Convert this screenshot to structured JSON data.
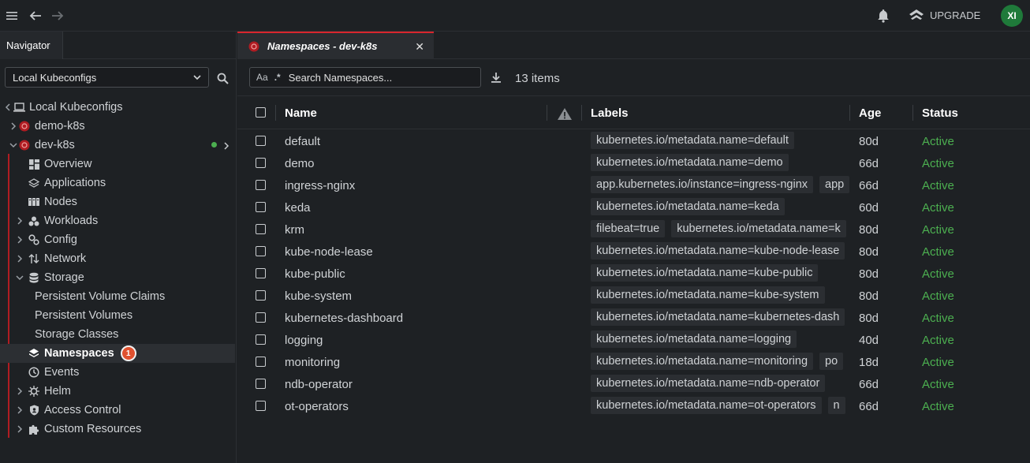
{
  "topbar": {
    "upgrade_label": "UPGRADE",
    "avatar_initials": "XI"
  },
  "sidebar": {
    "tab_label": "Navigator",
    "config_select": "Local Kubeconfigs",
    "tree": [
      {
        "label": "Local Kubeconfigs",
        "icon": "laptop-icon"
      },
      {
        "label": "demo-k8s",
        "icon": "cluster-icon"
      },
      {
        "label": "dev-k8s",
        "icon": "cluster-icon"
      },
      {
        "label": "Overview",
        "icon": "overview-icon"
      },
      {
        "label": "Applications",
        "icon": "applications-icon"
      },
      {
        "label": "Nodes",
        "icon": "nodes-icon"
      },
      {
        "label": "Workloads",
        "icon": "workloads-icon"
      },
      {
        "label": "Config",
        "icon": "config-icon"
      },
      {
        "label": "Network",
        "icon": "network-icon"
      },
      {
        "label": "Storage",
        "icon": "storage-icon"
      },
      {
        "label": "Persistent Volume Claims",
        "icon": ""
      },
      {
        "label": "Persistent Volumes",
        "icon": ""
      },
      {
        "label": "Storage Classes",
        "icon": ""
      },
      {
        "label": "Namespaces",
        "icon": "layers-icon",
        "badge": "1"
      },
      {
        "label": "Events",
        "icon": "clock-icon"
      },
      {
        "label": "Helm",
        "icon": "helm-icon"
      },
      {
        "label": "Access Control",
        "icon": "shield-icon"
      },
      {
        "label": "Custom Resources",
        "icon": "puzzle-icon"
      }
    ]
  },
  "main": {
    "tab_title": "Namespaces - dev-k8s",
    "search": {
      "case_opt": "Aa",
      "regex_opt": ".*",
      "placeholder": "Search Namespaces..."
    },
    "item_count": "13 items",
    "columns": {
      "name": "Name",
      "labels": "Labels",
      "age": "Age",
      "status": "Status"
    },
    "rows": [
      {
        "name": "default",
        "labels": [
          "kubernetes.io/metadata.name=default"
        ],
        "age": "80d",
        "status": "Active"
      },
      {
        "name": "demo",
        "labels": [
          "kubernetes.io/metadata.name=demo"
        ],
        "age": "66d",
        "status": "Active"
      },
      {
        "name": "ingress-nginx",
        "labels": [
          "app.kubernetes.io/instance=ingress-nginx",
          "app"
        ],
        "age": "66d",
        "status": "Active"
      },
      {
        "name": "keda",
        "labels": [
          "kubernetes.io/metadata.name=keda"
        ],
        "age": "60d",
        "status": "Active"
      },
      {
        "name": "krm",
        "labels": [
          "filebeat=true",
          "kubernetes.io/metadata.name=k"
        ],
        "age": "80d",
        "status": "Active"
      },
      {
        "name": "kube-node-lease",
        "labels": [
          "kubernetes.io/metadata.name=kube-node-lease"
        ],
        "age": "80d",
        "status": "Active"
      },
      {
        "name": "kube-public",
        "labels": [
          "kubernetes.io/metadata.name=kube-public"
        ],
        "age": "80d",
        "status": "Active"
      },
      {
        "name": "kube-system",
        "labels": [
          "kubernetes.io/metadata.name=kube-system"
        ],
        "age": "80d",
        "status": "Active"
      },
      {
        "name": "kubernetes-dashboard",
        "labels": [
          "kubernetes.io/metadata.name=kubernetes-dash"
        ],
        "age": "80d",
        "status": "Active"
      },
      {
        "name": "logging",
        "labels": [
          "kubernetes.io/metadata.name=logging"
        ],
        "age": "40d",
        "status": "Active"
      },
      {
        "name": "monitoring",
        "labels": [
          "kubernetes.io/metadata.name=monitoring",
          "po"
        ],
        "age": "18d",
        "status": "Active"
      },
      {
        "name": "ndb-operator",
        "labels": [
          "kubernetes.io/metadata.name=ndb-operator"
        ],
        "age": "66d",
        "status": "Active"
      },
      {
        "name": "ot-operators",
        "labels": [
          "kubernetes.io/metadata.name=ot-operators",
          "n"
        ],
        "age": "66d",
        "status": "Active"
      }
    ]
  },
  "colors": {
    "accent": "#d8262d",
    "status_active": "#4caf50",
    "badge": "#e0512f"
  }
}
